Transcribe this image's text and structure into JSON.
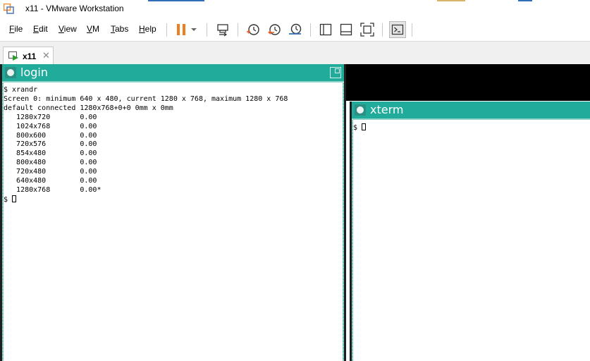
{
  "window": {
    "title": "x11 - VMware Workstation",
    "accents": [
      {
        "color": "#2f6fb7"
      },
      {
        "color": "#d8b46a"
      },
      {
        "color": "#2f6fb7"
      }
    ]
  },
  "menu": {
    "items": [
      {
        "label_u": "F",
        "label_rest": "ile"
      },
      {
        "label_u": "E",
        "label_rest": "dit"
      },
      {
        "label_u": "V",
        "label_rest": "iew"
      },
      {
        "label_u": "V",
        "label_rest": "M"
      },
      {
        "label_u": "T",
        "label_rest": "abs"
      },
      {
        "label_u": "H",
        "label_rest": "elp"
      }
    ]
  },
  "toolbar": {
    "icons": [
      "pause-icon",
      "dropdown-arrow-icon",
      "send-ctrl-alt-del-icon",
      "snapshot-icon",
      "revert-snapshot-icon",
      "snapshot-manager-icon",
      "show-library-icon",
      "show-thumbnail-bar-icon",
      "full-screen-icon",
      "console-view-icon"
    ],
    "colors": {
      "pause": "#f07d1e",
      "accent": "#e8612c"
    }
  },
  "tab": {
    "label": "x11",
    "close": "✕"
  },
  "x11": {
    "titlebar_color": "#21ab9b",
    "login": {
      "title": "login",
      "lines": [
        "$ xrandr",
        "Screen 0: minimum 640 x 480, current 1280 x 768, maximum 1280 x 768",
        "default connected 1280x768+0+0 0mm x 0mm",
        "   1280x720       0.00",
        "   1024x768       0.00",
        "   800x600        0.00",
        "   720x576        0.00",
        "   854x480        0.00",
        "   800x480        0.00",
        "   720x480        0.00",
        "   640x480        0.00",
        "   1280x768       0.00*"
      ],
      "prompt": "$ "
    },
    "xterm": {
      "title": "xterm",
      "prompt": "$ "
    }
  }
}
